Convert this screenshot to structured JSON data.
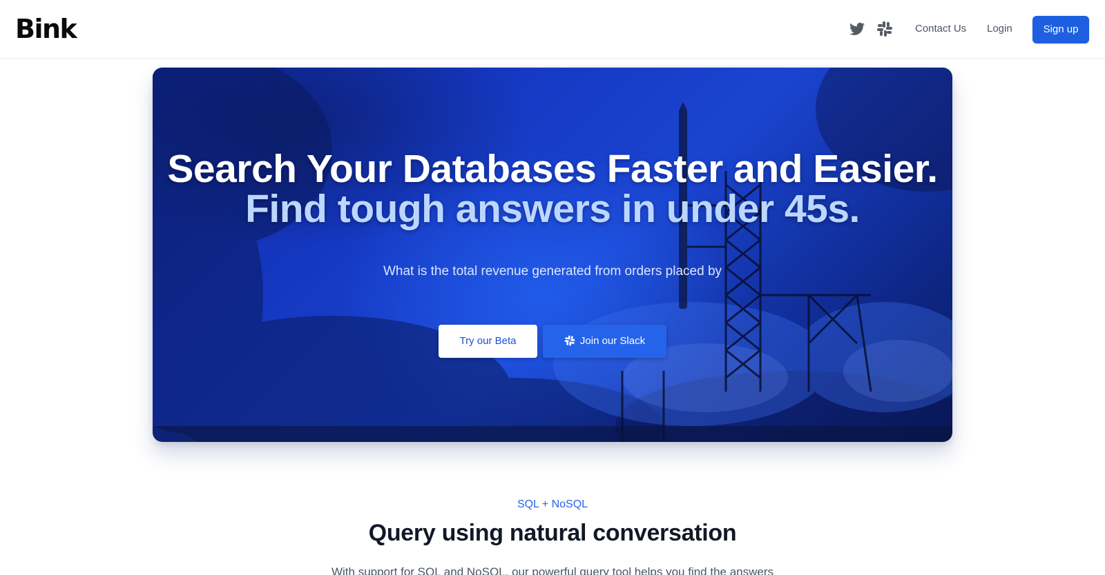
{
  "brand": {
    "logo_text": "Bink"
  },
  "nav": {
    "icons": [
      "twitter-icon",
      "slack-icon"
    ],
    "contact_label": "Contact Us",
    "login_label": "Login",
    "signup_label": "Sign up"
  },
  "hero": {
    "title_line1": "Search Your Databases Faster and Easier.",
    "title_line2": "Find tough answers in under 45s.",
    "query_text": "What is the total revenue generated from orders placed by",
    "beta_button": "Try our Beta",
    "slack_button": "Join our Slack",
    "slack_button_icon": "slack-icon"
  },
  "features": {
    "eyebrow": "SQL + NoSQL",
    "title": "Query using natural conversation",
    "description": "With support for SQL and NoSQL, our powerful query tool helps you find the answers"
  },
  "colors": {
    "accent": "#1d5fe0",
    "hero_blue": "#1a44d0",
    "hero_subtitle": "#bcd7ff",
    "eyebrow": "#2563eb"
  }
}
